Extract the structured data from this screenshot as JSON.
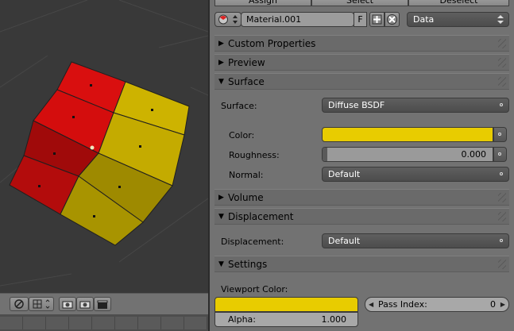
{
  "top_buttons": {
    "assign": "Assign",
    "select": "Select",
    "deselect": "Deselect"
  },
  "material": {
    "name": "Material.001",
    "fake_user": "F",
    "link_type": "Data"
  },
  "panels": {
    "custom_properties": "Custom Properties",
    "preview": "Preview",
    "surface": "Surface",
    "volume": "Volume",
    "displacement": "Displacement",
    "settings": "Settings"
  },
  "surface": {
    "surface_label": "Surface:",
    "surface_value": "Diffuse BSDF",
    "color_label": "Color:",
    "color_value": "#e8cc00",
    "roughness_label": "Roughness:",
    "roughness_value": "0.000",
    "normal_label": "Normal:",
    "normal_value": "Default"
  },
  "displacement": {
    "label": "Displacement:",
    "value": "Default"
  },
  "settings": {
    "viewport_color_label": "Viewport Color:",
    "viewport_color": "#e8cc00",
    "alpha_label": "Alpha:",
    "alpha_value": "1.000",
    "pass_index_label": "Pass Index:",
    "pass_index_value": "0"
  },
  "icons": [
    "material-sphere-icon",
    "up-down-arrows-icon",
    "plus-icon",
    "close-icon",
    "chevron-down-icon",
    "magnet-icon",
    "snap-icon",
    "camera-icon",
    "clapperboard-icon"
  ]
}
